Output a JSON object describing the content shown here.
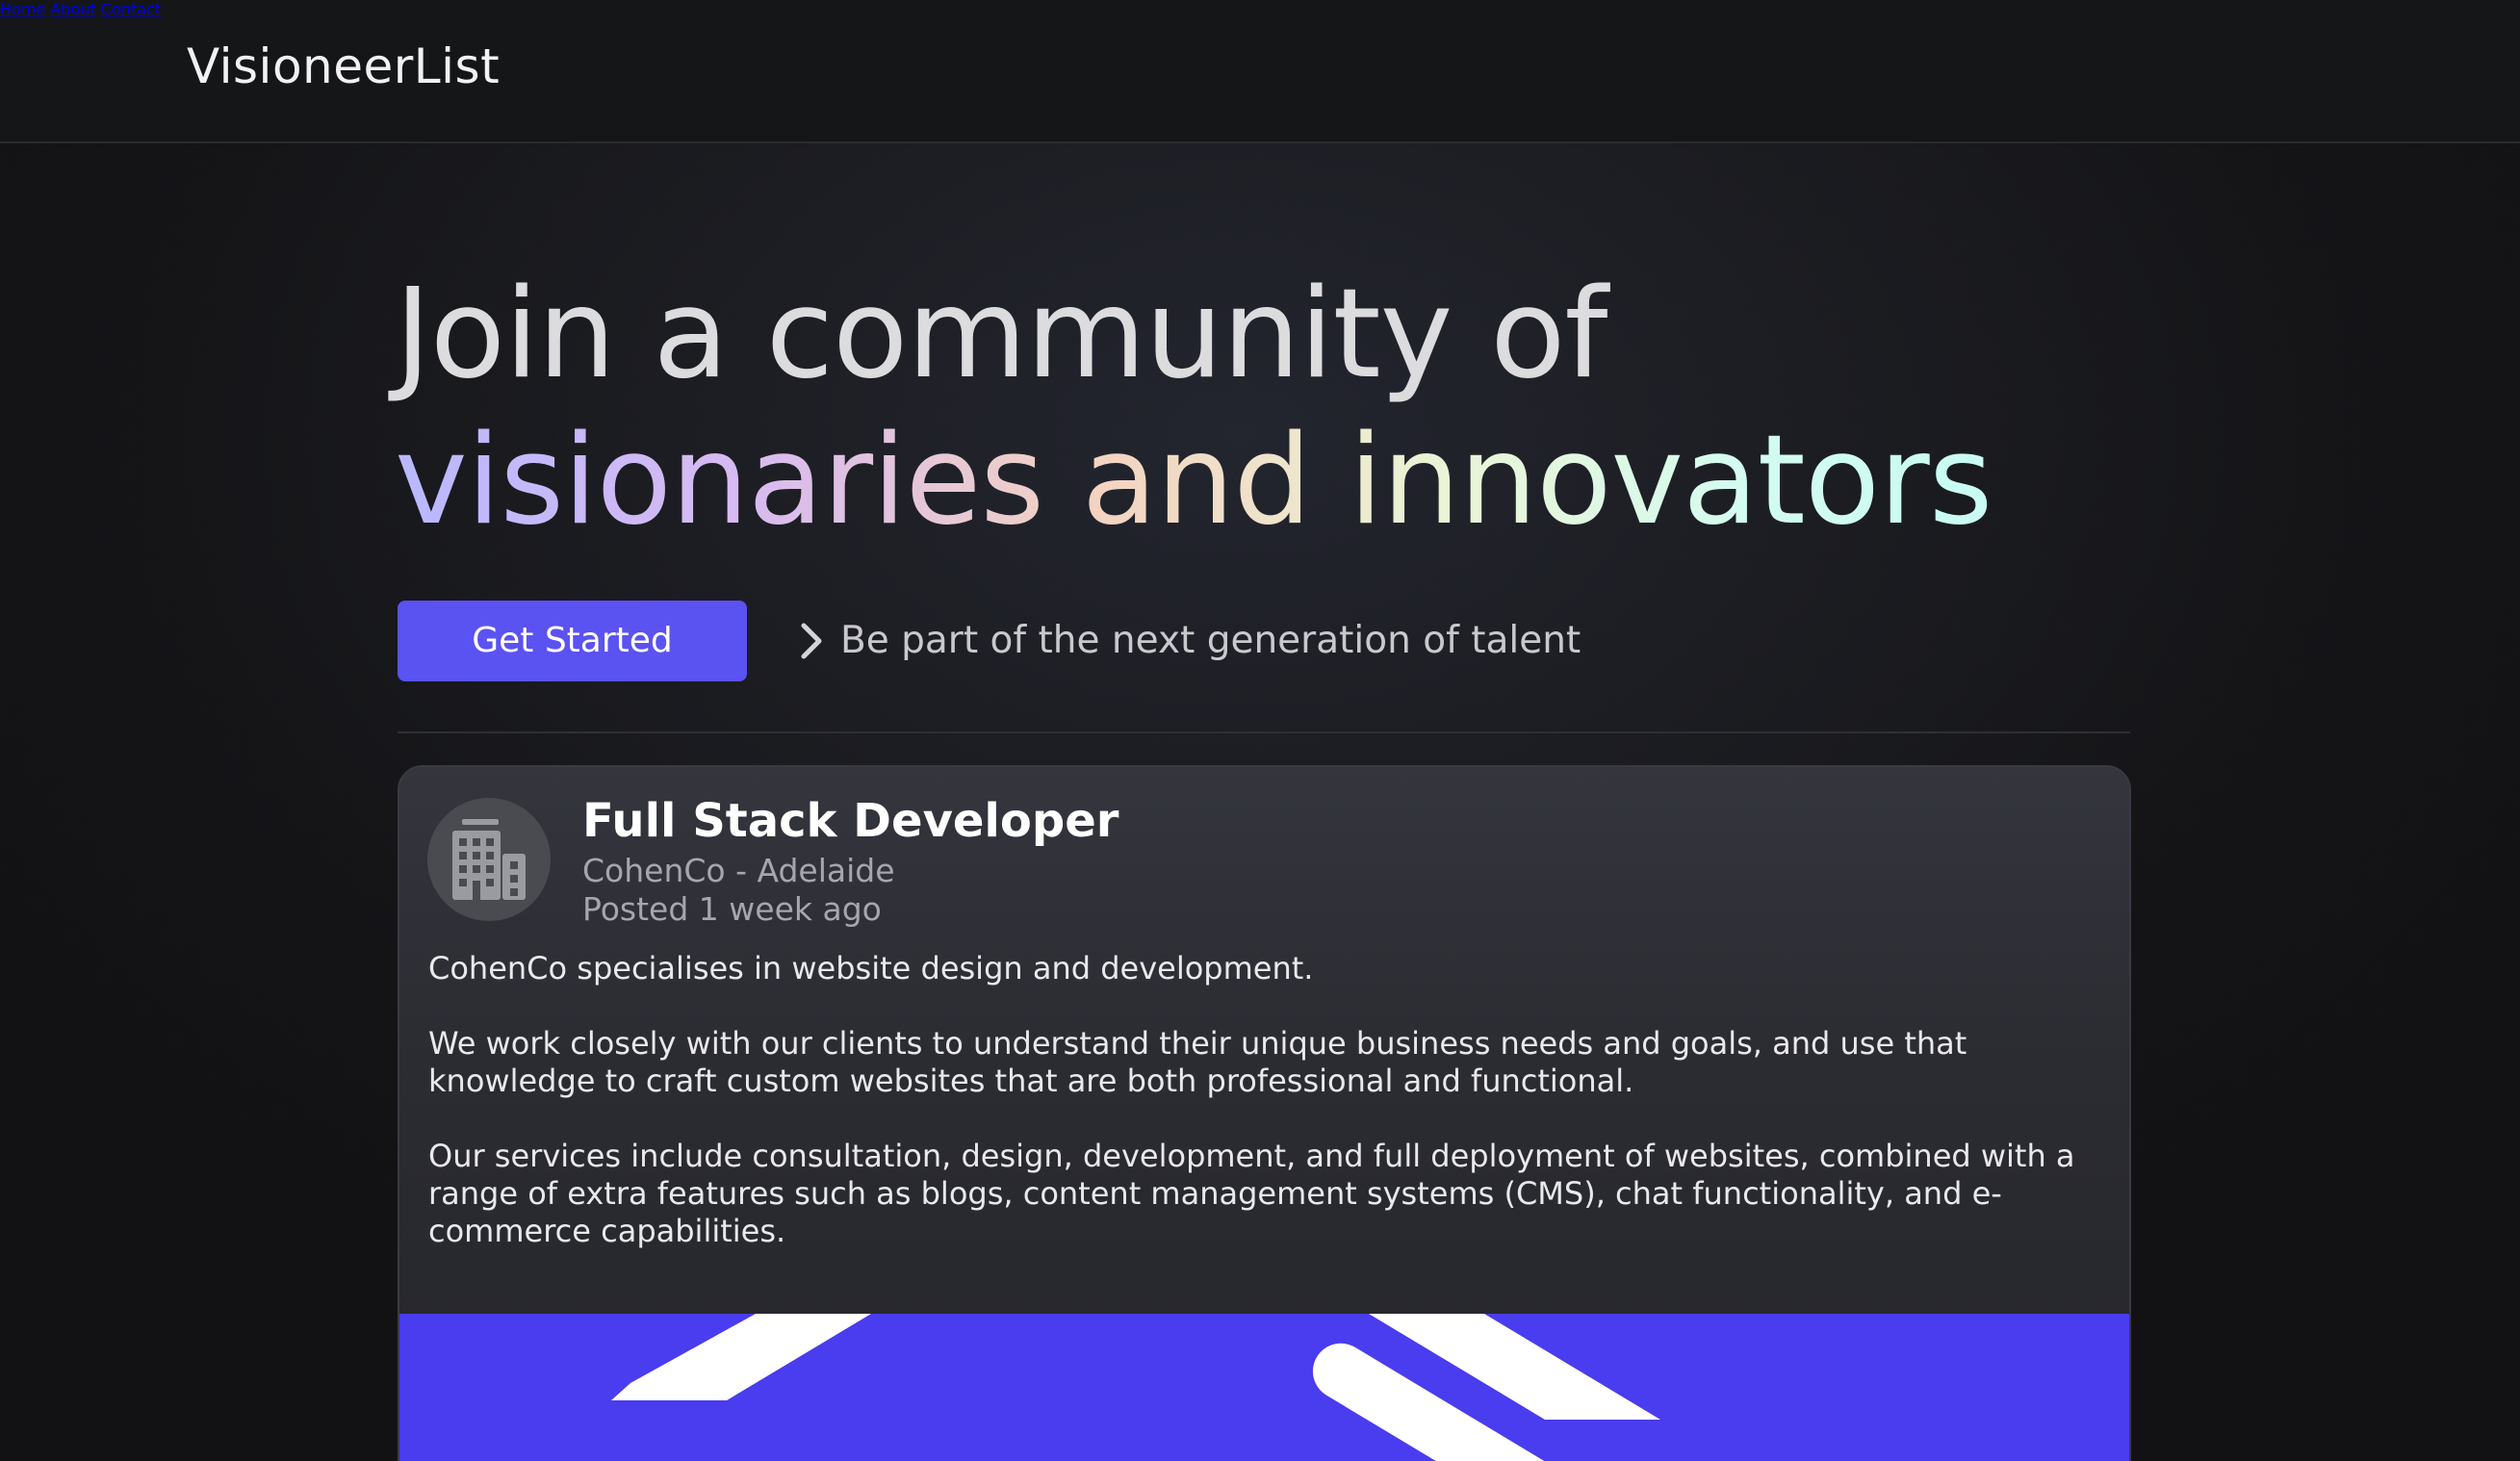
{
  "brand": "VisioneerList",
  "nav": {
    "items": [
      {
        "label": "Home"
      },
      {
        "label": "About"
      },
      {
        "label": "Contact"
      }
    ]
  },
  "hero": {
    "title_line1": "Join a community of",
    "title_line2": "visionaries and innovators",
    "gradient_colors": [
      "#b9b8ff",
      "#d7baf0",
      "#f3d3c0",
      "#eaf4d6",
      "#d4fbef",
      "#c8fbf4"
    ],
    "cta_label": "Get Started",
    "cta_color": "#5b52f2",
    "tagline": "Be part of the next generation of talent",
    "tagline_icon": "chevron-right-icon"
  },
  "job": {
    "title": "Full Stack Developer",
    "company_location": "CohenCo - Adelaide",
    "posted": "Posted 1 week ago",
    "logo_icon": "building-icon",
    "description": [
      "CohenCo specialises in website design and development.",
      "We work closely with our clients to understand their unique business needs and goals, and use that knowledge to craft custom websites that are both professional and functional.",
      "Our services include consultation, design, development, and full deployment of websites, combined with a range of extra features such as blogs, content management systems (CMS), chat functionality, and e-commerce capabilities."
    ],
    "banner_color": "#4a3cef"
  }
}
